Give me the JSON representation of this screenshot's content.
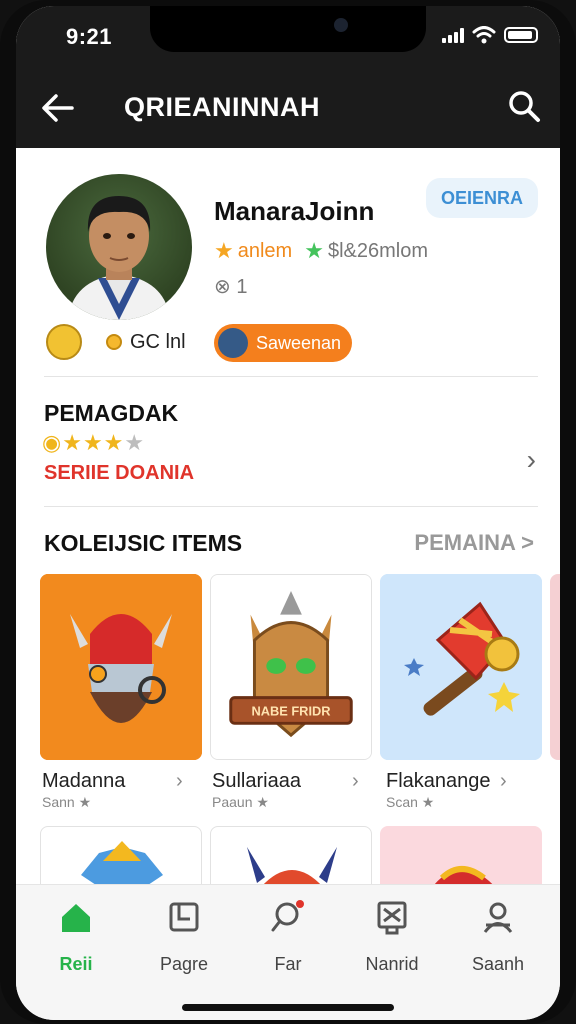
{
  "status": {
    "time": "9:21"
  },
  "appbar": {
    "title": "QRIEANINNAH"
  },
  "profile": {
    "name": "ManaraJoinn",
    "badge": "OEIENRA",
    "rating_label": "anlem",
    "score_label": "$l&26mlom",
    "level": "1",
    "coins": "GC lnl",
    "follow_button": "Saweenan"
  },
  "rating": {
    "title": "PEMAGDAK",
    "stars_filled": 3,
    "stars_total": 5,
    "subtitle": "SERIIE DOANIA"
  },
  "collection": {
    "title": "KOLEIJSIC ITEMS",
    "see_all": "PEMAINA >",
    "items": [
      {
        "name": "Madanna",
        "sub": "Sann ★"
      },
      {
        "name": "Sullariaaa",
        "sub": "Paaun ★"
      },
      {
        "name": "Flakanange",
        "sub": "Scan ★"
      }
    ],
    "banner_text": "NABE FRIDR"
  },
  "tabs": [
    {
      "label": "Reii"
    },
    {
      "label": "Pagre"
    },
    {
      "label": "Far"
    },
    {
      "label": "Nanrid"
    },
    {
      "label": "Saanh"
    }
  ],
  "colors": {
    "accent_orange": "#f47f1d",
    "active_green": "#26b34a",
    "rating_red": "#e0342b",
    "badge_blue": "#3d8fd4"
  }
}
